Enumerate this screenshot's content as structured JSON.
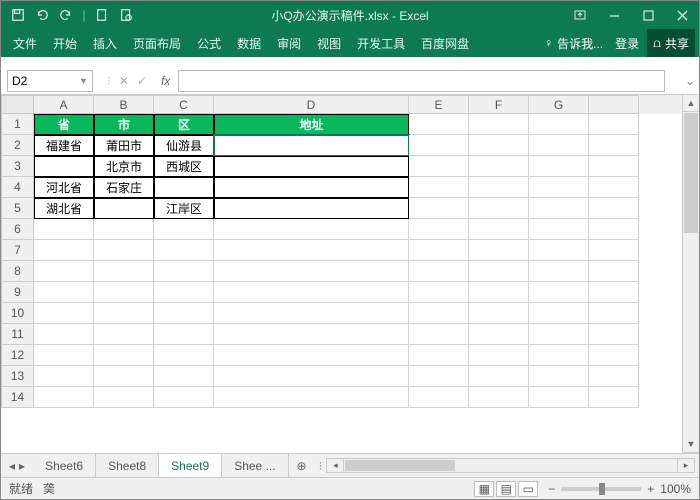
{
  "window": {
    "title": "小Q办公演示稿件.xlsx - Excel"
  },
  "ribbon": {
    "tabs": [
      "文件",
      "开始",
      "插入",
      "页面布局",
      "公式",
      "数据",
      "审阅",
      "视图",
      "开发工具",
      "百度网盘"
    ],
    "tell": "告诉我...",
    "login": "登录",
    "share": "共享"
  },
  "namebox": {
    "value": "D2"
  },
  "grid": {
    "cols": [
      "A",
      "B",
      "C",
      "D",
      "E",
      "F",
      "G",
      ""
    ],
    "rownums": [
      "1",
      "2",
      "3",
      "4",
      "5",
      "6",
      "7",
      "8",
      "9",
      "10",
      "11",
      "12",
      "13",
      "14"
    ],
    "headers": {
      "A": "省",
      "B": "市",
      "C": "区",
      "D": "地址"
    },
    "data": [
      {
        "A": "福建省",
        "B": "莆田市",
        "C": "仙游县",
        "D": ""
      },
      {
        "A": "",
        "B": "北京市",
        "C": "西城区",
        "D": ""
      },
      {
        "A": "河北省",
        "B": "石家庄",
        "C": "",
        "D": ""
      },
      {
        "A": "湖北省",
        "B": "",
        "C": "江岸区",
        "D": ""
      }
    ]
  },
  "sheets": {
    "tabs": [
      "Sheet6",
      "Sheet8",
      "Sheet9",
      "Shee ..."
    ],
    "active": 2
  },
  "status": {
    "ready": "就绪",
    "calc": "䶮",
    "zoom": "100%"
  }
}
